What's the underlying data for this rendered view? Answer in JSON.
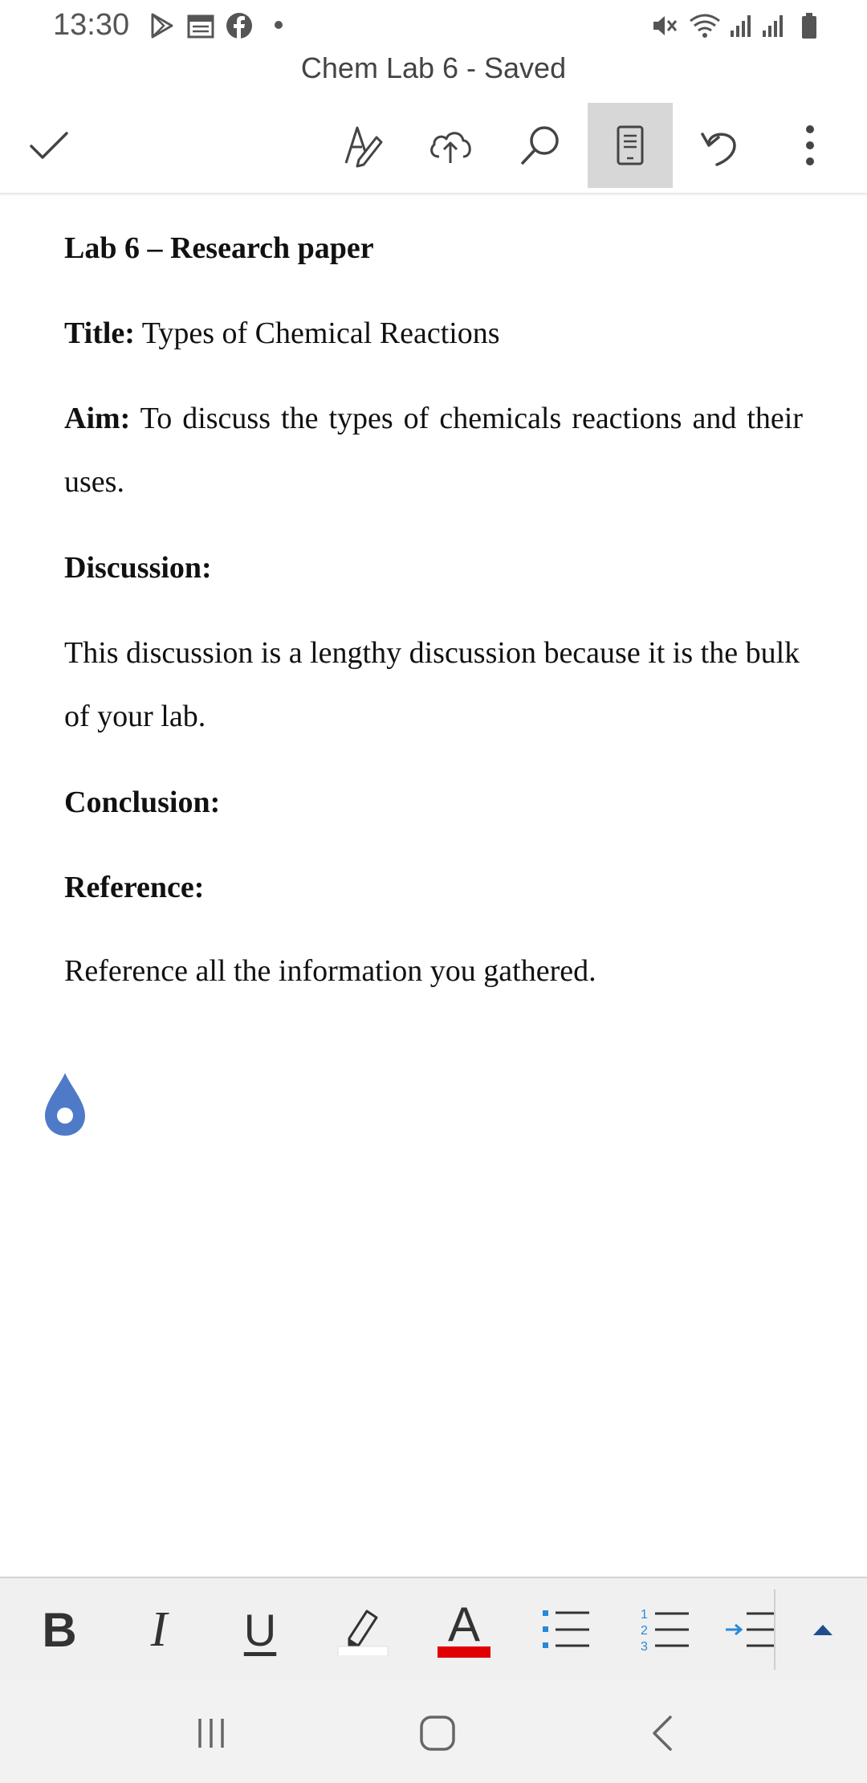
{
  "status_bar": {
    "time": "13:30",
    "left_icons": [
      "play-store-icon",
      "calendar-icon",
      "facebook-icon",
      "notification-dot"
    ],
    "right_icons": [
      "mute-icon",
      "wifi-icon",
      "signal-icon",
      "signal-icon",
      "battery-icon"
    ]
  },
  "app": {
    "title": "Chem Lab 6 - Saved"
  },
  "toolbar": {
    "icons": [
      "check-icon",
      "draw-pen-icon",
      "cloud-upload-icon",
      "search-icon",
      "mobile-view-icon",
      "undo-icon",
      "more-options-icon"
    ],
    "active": "mobile-view-icon"
  },
  "document": {
    "heading": "Lab 6 – Research paper",
    "title_label": "Title:",
    "title_value": " Types of Chemical Reactions",
    "aim_label": "Aim:",
    "aim_value": " To discuss the types of chemicals reactions and their uses.",
    "discussion_label": "Discussion:",
    "discussion_text": "This discussion is a lengthy discussion because it is the bulk of your lab.",
    "conclusion_label": "Conclusion:",
    "reference_label": "Reference:",
    "reference_text": "Reference all the information you gathered."
  },
  "format_bar": {
    "bold": "B",
    "italic": "I",
    "underline": "U",
    "font_color_glyph": "A",
    "highlight_color": "#ffffff",
    "font_color": "#e00000",
    "list_accent": "#2a88d8"
  },
  "colors": {
    "cursor_handle": "#4f7ac8",
    "active_toolbar_bg": "#d7d7d7"
  }
}
